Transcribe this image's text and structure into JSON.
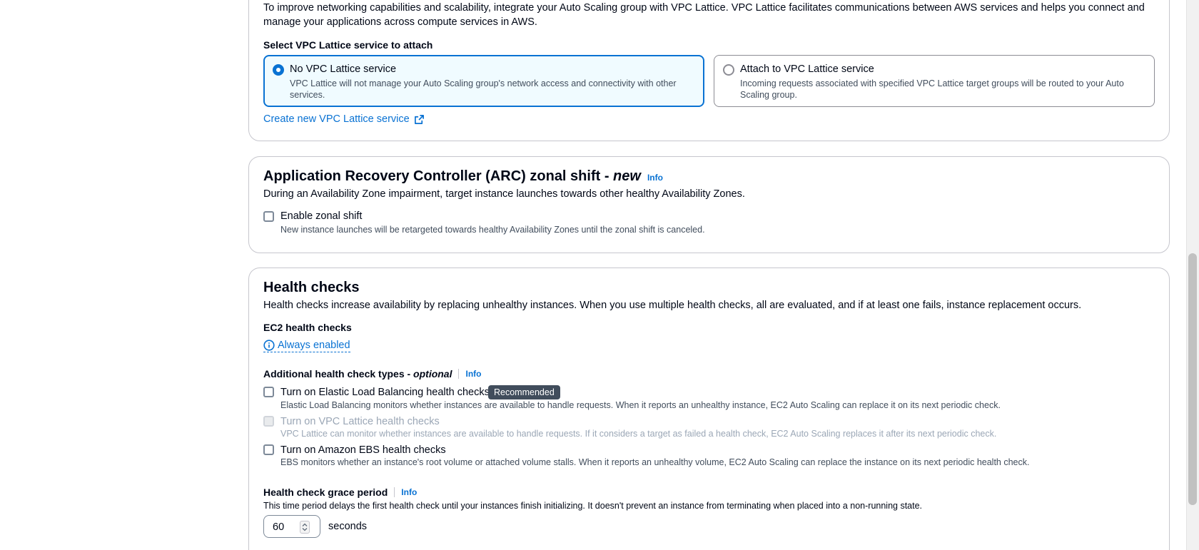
{
  "lattice": {
    "intro": "To improve networking capabilities and scalability, integrate your Auto Scaling group with VPC Lattice. VPC Lattice facilitates communications between AWS services and helps you connect and manage your applications across compute services in AWS.",
    "select_label": "Select VPC Lattice service to attach",
    "option_none_title": "No VPC Lattice service",
    "option_none_desc": "VPC Lattice will not manage your Auto Scaling group's network access and connectivity with other services.",
    "option_attach_title": "Attach to VPC Lattice service",
    "option_attach_desc": "Incoming requests associated with specified VPC Lattice target groups will be routed to your Auto Scaling group.",
    "create_link": "Create new VPC Lattice service"
  },
  "arc": {
    "title": "Application Recovery Controller (ARC) zonal shift - ",
    "title_new": "new",
    "info": "Info",
    "description": "During an Availability Zone impairment, target instance launches towards other healthy Availability Zones.",
    "checkbox_label": "Enable zonal shift",
    "checkbox_desc": "New instance launches will be retargeted towards healthy Availability Zones until the zonal shift is canceled."
  },
  "health": {
    "title": "Health checks",
    "description": "Health checks increase availability by replacing unhealthy instances. When you use multiple health checks, all are evaluated, and if at least one fails, instance replacement occurs.",
    "ec2_label": "EC2 health checks",
    "ec2_value": "Always enabled",
    "additional_label": "Additional health check types - ",
    "additional_optional": "optional",
    "info": "Info",
    "elb_label": "Turn on Elastic Load Balancing health checks",
    "elb_badge": "Recommended",
    "elb_desc": "Elastic Load Balancing monitors whether instances are available to handle requests. When it reports an unhealthy instance, EC2 Auto Scaling can replace it on its next periodic check.",
    "lattice_label": "Turn on VPC Lattice health checks",
    "lattice_desc": "VPC Lattice can monitor whether instances are available to handle requests. If it considers a target as failed a health check, EC2 Auto Scaling replaces it after its next periodic check.",
    "ebs_label": "Turn on Amazon EBS health checks",
    "ebs_desc": "EBS monitors whether an instance's root volume or attached volume stalls. When it reports an unhealthy volume, EC2 Auto Scaling can replace the instance on its next periodic health check.",
    "grace_label": "Health check grace period",
    "grace_info": "Info",
    "grace_desc": "This time period delays the first health check until your instances finish initializing. It doesn't prevent an instance from terminating when placed into a non-running state.",
    "grace_value": "60",
    "grace_unit": "seconds"
  },
  "colors": {
    "accent": "#0972d3",
    "badge_bg": "#414d5c"
  },
  "icons": {
    "external": "external-link-icon",
    "info_circle": "info-circle-icon",
    "stepper": "stepper-arrows-icon"
  }
}
